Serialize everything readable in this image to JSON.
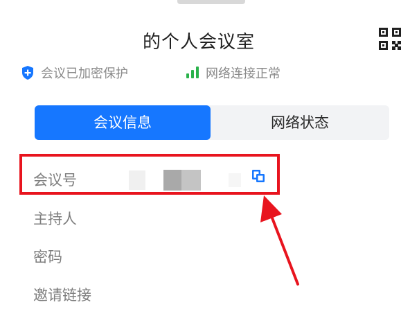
{
  "header": {
    "title": "的个人会议室",
    "qr_icon": "qr-code-icon"
  },
  "status": {
    "encrypted_label": "会议已加密保护",
    "encrypted_icon": "shield-plus-icon",
    "network_label": "网络连接正常",
    "network_icon": "signal-bars-icon"
  },
  "tabs": [
    {
      "label": "会议信息",
      "active": true
    },
    {
      "label": "网络状态",
      "active": false
    }
  ],
  "info_rows": {
    "meeting_number_label": "会议号",
    "host_label": "主持人",
    "password_label": "密码",
    "invite_link_label": "邀请链接",
    "copy_icon": "copy-icon"
  },
  "colors": {
    "accent": "#1677ff",
    "network_ok": "#2ab24b",
    "annotation": "#e8141e"
  }
}
